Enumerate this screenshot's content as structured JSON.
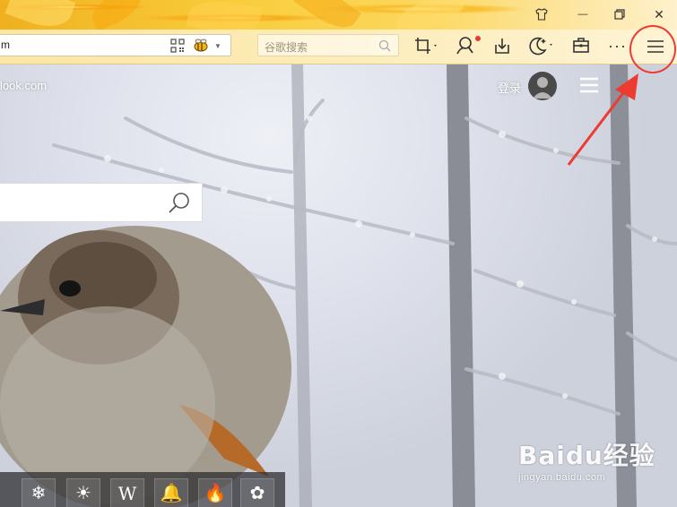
{
  "browser": {
    "address_text": "m",
    "search_placeholder": "谷歌搜索",
    "icons": [
      "qr-code-icon",
      "bee-icon",
      "crop-icon",
      "user-search-icon",
      "download-icon",
      "night-mode-icon",
      "toolbox-icon",
      "more-icon",
      "menu-icon"
    ],
    "window_controls": [
      "skin-icon",
      "minimize-icon",
      "restore-icon",
      "close-icon"
    ],
    "more_glyph": "···",
    "min_glyph": "—",
    "close_glyph": "✕"
  },
  "page": {
    "site_text": "look.com",
    "login_label": "登录"
  },
  "bottom_bar": {
    "items": [
      "❄",
      "☀",
      "W",
      "🔔",
      "🔥",
      "✿"
    ]
  },
  "watermark": {
    "logo": "Baidu经验",
    "sub": "jingyan.baidu.com"
  },
  "colors": {
    "annotation": "#ee3b32",
    "titlebar": "#f3b324",
    "toolbar": "#fcecb8"
  }
}
